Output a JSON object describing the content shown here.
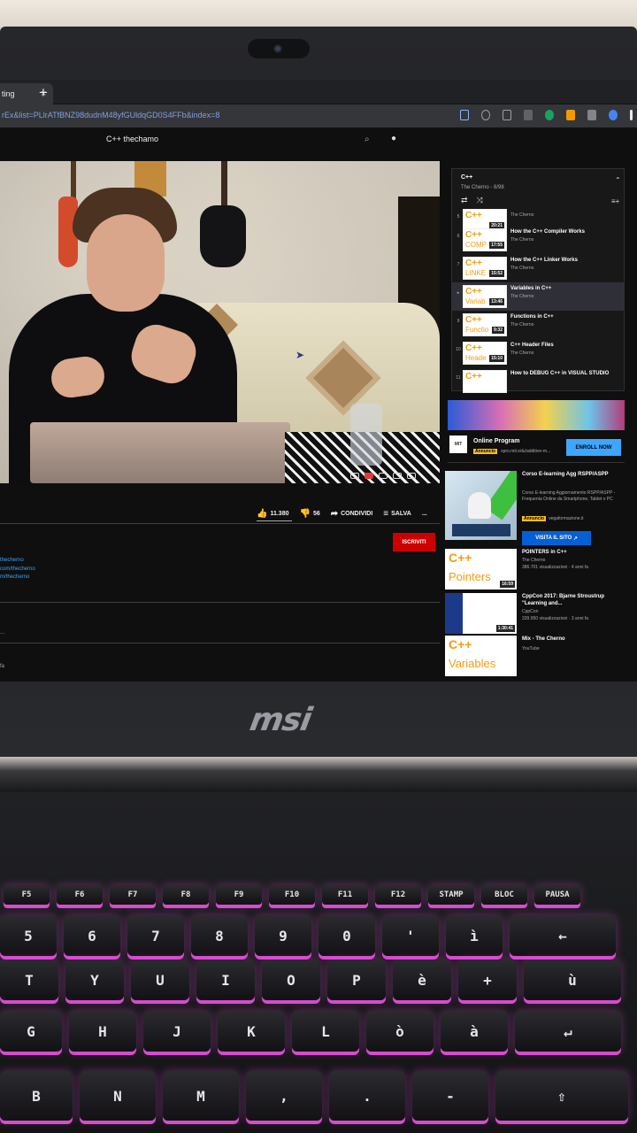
{
  "browser": {
    "tab_title": "ting",
    "tab_close": "×",
    "new_tab": "+",
    "url": "rEx&list=PLlrATfBNZ98dudnM48yfGUldqGD0S4FFb&index=8"
  },
  "youtube": {
    "header_title": "C++ thechamo"
  },
  "video": {
    "actions": {
      "likes": "11.380",
      "dislikes": "56",
      "share": "CONDIVIDI",
      "save": "SALVA",
      "more": "..."
    },
    "subscribe": "ISCRIVITI",
    "description_links": [
      "thecherno",
      "com/thecherno",
      "m/thecherno"
    ],
    "footer_lines": [
      "...",
      "fa"
    ]
  },
  "playlist": {
    "title": "C++",
    "subtitle": "The Cherno - 8/98",
    "items": [
      {
        "num": "5",
        "thumb_word": "",
        "duration": "20:21",
        "name": "",
        "channel": "The Cherno"
      },
      {
        "num": "6",
        "thumb_word": "COMP",
        "duration": "17:55",
        "name": "How the C++ Compiler Works",
        "channel": "The Cherno"
      },
      {
        "num": "7",
        "thumb_word": "LINKE",
        "duration": "15:52",
        "name": "How the C++ Linker Works",
        "channel": "The Cherno"
      },
      {
        "num": "▸",
        "thumb_word": "Variab",
        "duration": "13:46",
        "name": "Variables in C++",
        "channel": "The Cherno"
      },
      {
        "num": "9",
        "thumb_word": "Functio",
        "duration": "9:32",
        "name": "Functions in C++",
        "channel": "The Cherno"
      },
      {
        "num": "10",
        "thumb_word": "Heade",
        "duration": "15:10",
        "name": "C++ Header Files",
        "channel": "The Cherno"
      },
      {
        "num": "11",
        "thumb_word": "",
        "duration": "",
        "name": "How to DEBUG C++ in VISUAL STUDIO",
        "channel": ""
      }
    ]
  },
  "ad": {
    "logo": "MIT",
    "title": "Online Program",
    "badge": "Annuncio",
    "url": "xpro.mit.edu/additive-m...",
    "button": "ENROLL NOW"
  },
  "related": [
    {
      "title": "Corso E-learning Agg RSPP/ASPP",
      "meta": "Corso E-learning Aggiornamento RSPP/ASPP - Frequenta Online da Smartphone, Tablet o PC",
      "badge": "Annuncio",
      "url": "vegaformazione.it",
      "button": "VISITA IL SITO"
    },
    {
      "title": "POINTERS in C++",
      "thumb_word": "Pointers",
      "duration": "16:59",
      "channel": "The Cherno",
      "views": "386.701 visualizzazioni · 4 anni fa"
    },
    {
      "title": "CppCon 2017: Bjarne Stroustrup \"Learning and...",
      "duration": "1:30:41",
      "channel": "CppCon",
      "views": "339.950 visualizzazioni · 3 anni fa"
    },
    {
      "title": "Mix - The Cherno",
      "thumb_word": "Variables",
      "channel": "YouTube"
    }
  ],
  "laptop": {
    "brand": "msi"
  },
  "keyboard": {
    "frow": [
      "F5",
      "F6",
      "F7",
      "F8",
      "F9",
      "F10",
      "F11",
      "F12",
      "STAMP",
      "BLOC",
      "PAUSA"
    ],
    "row1": [
      "5",
      "6",
      "7",
      "8",
      "9",
      "0",
      "'",
      "ì",
      "←"
    ],
    "row2": [
      "T",
      "Y",
      "U",
      "I",
      "O",
      "P",
      "è",
      "+",
      "ù"
    ],
    "row3": [
      "G",
      "H",
      "J",
      "K",
      "L",
      "ò",
      "à",
      "↵"
    ],
    "row4": [
      "B",
      "N",
      "M",
      ",",
      ".",
      "-",
      "⇧"
    ]
  },
  "colors": {
    "accent_red": "#cc0000",
    "link_blue": "#3ea6ff",
    "keyboard_glow": "#d84bd0",
    "ad_badge": "#f9bd22"
  }
}
